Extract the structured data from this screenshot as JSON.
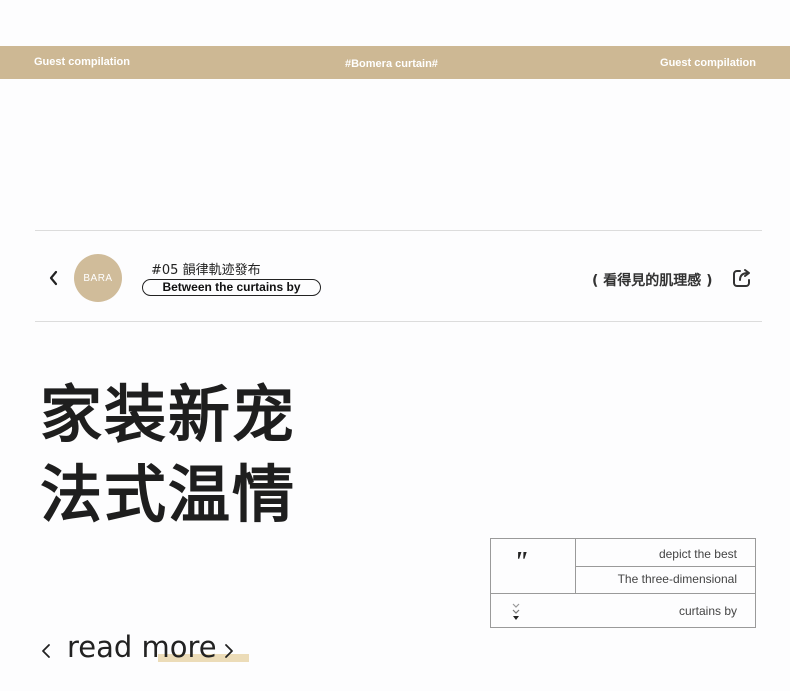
{
  "banner": {
    "left": "Guest compilation",
    "center": "#Bomera curtain#",
    "right": "Guest compilation"
  },
  "header": {
    "logo_text": "BARA",
    "issue": "#05 韻律軌迹發布",
    "tagline": "Between the curtains by",
    "texture": "( 看得見的肌理感 )"
  },
  "headline": {
    "line1": "家装新宠",
    "line2": "法式温情"
  },
  "quote_box": {
    "mark": "\"",
    "row1": "depict the best",
    "row2": "The three-dimensional",
    "row3": "curtains by"
  },
  "read_more": {
    "label": "read more"
  },
  "colors": {
    "accent": "#cdb894",
    "highlight": "#ecdcb8"
  },
  "icons": {
    "back": "chevron-left-icon",
    "share": "share-icon",
    "read_prev": "chevron-left-icon",
    "read_next": "chevron-right-icon"
  }
}
